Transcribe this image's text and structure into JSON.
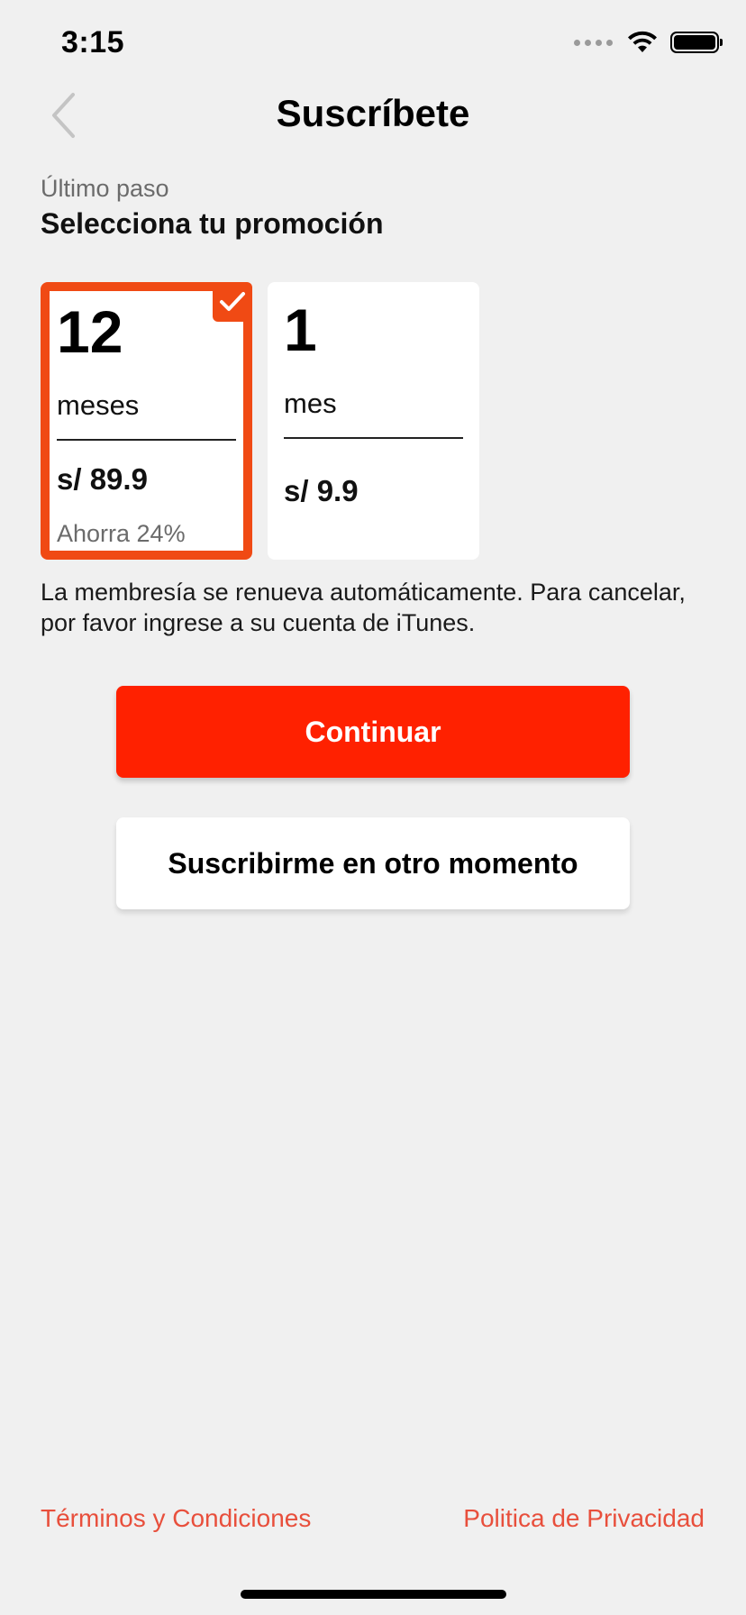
{
  "status_bar": {
    "time": "3:15",
    "icons": [
      "signal-icon",
      "wifi-icon",
      "battery-icon"
    ]
  },
  "nav": {
    "title": "Suscríbete",
    "back_icon": "chevron-left-icon"
  },
  "step": {
    "label": "Último paso",
    "title": "Selecciona tu promoción"
  },
  "plans": [
    {
      "number": "12",
      "unit": "meses",
      "price": "s/ 89.9",
      "saving": "Ahorra 24%",
      "selected": true
    },
    {
      "number": "1",
      "unit": "mes",
      "price": "s/ 9.9",
      "saving": "",
      "selected": false
    }
  ],
  "note": "La membresía se renueva automáticamente. Para cancelar, por favor ingrese a su cuenta de iTunes.",
  "buttons": {
    "continue": "Continuar",
    "later": "Suscribirme en otro momento"
  },
  "footer": {
    "terms": "Términos y Condiciones",
    "privacy": "Politica de Privacidad"
  },
  "colors": {
    "accent": "#ff2100",
    "selected_border": "#f04a14",
    "link": "#e84f3c",
    "background": "#f0f0f0"
  }
}
